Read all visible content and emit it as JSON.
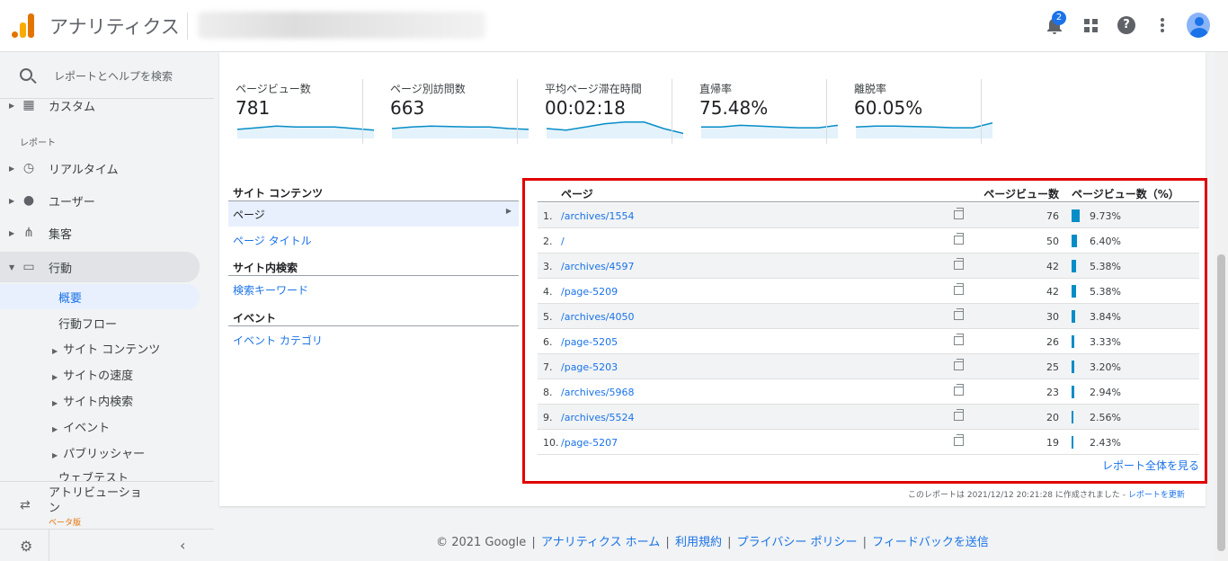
{
  "header": {
    "app_title": "アナリティクス",
    "notification_count": "2"
  },
  "sidebar": {
    "search_placeholder": "レポートとヘルプを検索",
    "custom_label": "カスタム",
    "reports_section": "レポート",
    "items": [
      {
        "label": "リアルタイム"
      },
      {
        "label": "ユーザー"
      },
      {
        "label": "集客"
      },
      {
        "label": "行動"
      }
    ],
    "sub_items": {
      "overview": "概要",
      "behavior_flow": "行動フロー",
      "site_content": "サイト コンテンツ",
      "site_speed": "サイトの速度",
      "site_search": "サイト内検索",
      "events": "イベント",
      "publisher": "パブリッシャー",
      "experiments": "ウェブテスト"
    },
    "attribution_label": "アトリビューション",
    "attribution_beta": "ベータ版"
  },
  "metrics": [
    {
      "label": "ページビュー数",
      "value": "781",
      "spark": [
        0.55,
        0.45,
        0.35,
        0.4,
        0.4,
        0.4,
        0.5,
        0.6
      ]
    },
    {
      "label": "ページ別訪問数",
      "value": "663",
      "spark": [
        0.5,
        0.4,
        0.35,
        0.38,
        0.4,
        0.4,
        0.5,
        0.55
      ]
    },
    {
      "label": "平均ページ滞在時間",
      "value": "00:02:18",
      "spark": [
        0.5,
        0.6,
        0.4,
        0.2,
        0.1,
        0.1,
        0.5,
        0.8
      ]
    },
    {
      "label": "直帰率",
      "value": "75.48%",
      "spark": [
        0.4,
        0.4,
        0.3,
        0.35,
        0.4,
        0.45,
        0.45,
        0.3
      ]
    },
    {
      "label": "離脱率",
      "value": "60.05%",
      "spark": [
        0.4,
        0.35,
        0.35,
        0.38,
        0.4,
        0.45,
        0.45,
        0.15
      ]
    }
  ],
  "left_nav": {
    "site_content_header": "サイト コンテンツ",
    "page_label": "ページ",
    "page_title_link": "ページ タイトル",
    "site_search_header": "サイト内検索",
    "search_keyword_link": "検索キーワード",
    "events_header": "イベント",
    "event_category_link": "イベント カテゴリ"
  },
  "table": {
    "col_page": "ページ",
    "col_pageviews": "ページビュー数",
    "col_pageviews_pct": "ページビュー数（%）",
    "rows": [
      {
        "num": "1.",
        "page": "/archives/1554",
        "views": "76",
        "pct": "9.73%",
        "pct_value": 9.73
      },
      {
        "num": "2.",
        "page": "/",
        "views": "50",
        "pct": "6.40%",
        "pct_value": 6.4
      },
      {
        "num": "3.",
        "page": "/archives/4597",
        "views": "42",
        "pct": "5.38%",
        "pct_value": 5.38
      },
      {
        "num": "4.",
        "page": "/page-5209",
        "views": "42",
        "pct": "5.38%",
        "pct_value": 5.38
      },
      {
        "num": "5.",
        "page": "/archives/4050",
        "views": "30",
        "pct": "3.84%",
        "pct_value": 3.84
      },
      {
        "num": "6.",
        "page": "/page-5205",
        "views": "26",
        "pct": "3.33%",
        "pct_value": 3.33
      },
      {
        "num": "7.",
        "page": "/page-5203",
        "views": "25",
        "pct": "3.20%",
        "pct_value": 3.2
      },
      {
        "num": "8.",
        "page": "/archives/5968",
        "views": "23",
        "pct": "2.94%",
        "pct_value": 2.94
      },
      {
        "num": "9.",
        "page": "/archives/5524",
        "views": "20",
        "pct": "2.56%",
        "pct_value": 2.56
      },
      {
        "num": "10.",
        "page": "/page-5207",
        "views": "19",
        "pct": "2.43%",
        "pct_value": 2.43
      }
    ],
    "full_report_link": "レポート全体を見る"
  },
  "report_created": "このレポートは 2021/12/12 20:21:28 に作成されました - ",
  "refresh_link": "レポートを更新",
  "footer": {
    "copyright": "© 2021 Google",
    "links": [
      "アナリティクス ホーム",
      "利用規約",
      "プライバシー ポリシー",
      "フィードバックを送信"
    ]
  },
  "colors": {
    "accent": "#1a73e8",
    "bar": "#058dc7",
    "highlight_border": "#e00000"
  }
}
